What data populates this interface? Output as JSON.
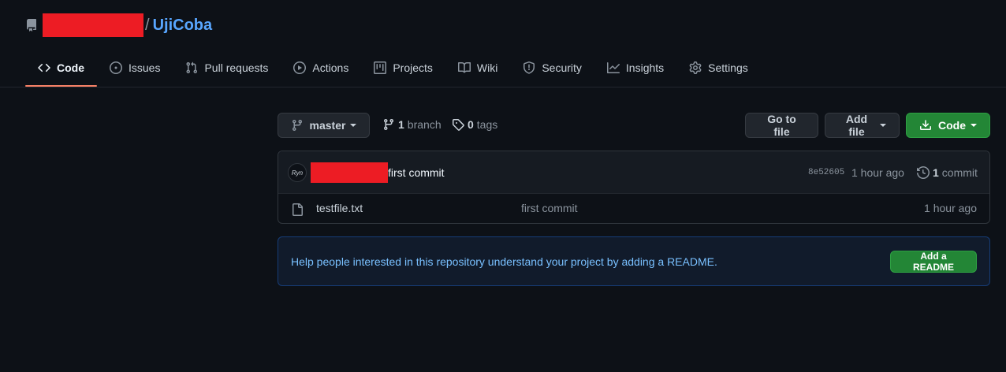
{
  "repo": {
    "name": "UjiCoba",
    "separator": "/"
  },
  "nav": {
    "tabs": [
      {
        "label": "Code",
        "icon": "code-icon",
        "active": true
      },
      {
        "label": "Issues",
        "icon": "issue-icon"
      },
      {
        "label": "Pull requests",
        "icon": "pull-request-icon"
      },
      {
        "label": "Actions",
        "icon": "play-icon"
      },
      {
        "label": "Projects",
        "icon": "project-icon"
      },
      {
        "label": "Wiki",
        "icon": "book-icon"
      },
      {
        "label": "Security",
        "icon": "shield-icon"
      },
      {
        "label": "Insights",
        "icon": "graph-icon"
      },
      {
        "label": "Settings",
        "icon": "gear-icon"
      }
    ]
  },
  "toolbar": {
    "branch_label": "master",
    "branch_count": "1",
    "branch_word": "branch",
    "tag_count": "0",
    "tag_word": "tags",
    "goto_file": "Go to file",
    "add_file": "Add file",
    "code": "Code"
  },
  "latest_commit": {
    "avatar_text": "Ryn",
    "message": "first commit",
    "sha": "8e52605",
    "time": "1 hour ago",
    "commit_count": "1",
    "commit_word": "commit"
  },
  "files": [
    {
      "name": "testfile.txt",
      "commit_message": "first commit",
      "time": "1 hour ago"
    }
  ],
  "readme_prompt": {
    "text": "Help people interested in this repository understand your project by adding a README.",
    "button": "Add a README"
  },
  "colors": {
    "background": "#0d1117",
    "link": "#58a6ff",
    "active_tab_underline": "#f78166",
    "green_button": "#238636",
    "redaction": "#ed1c24"
  }
}
